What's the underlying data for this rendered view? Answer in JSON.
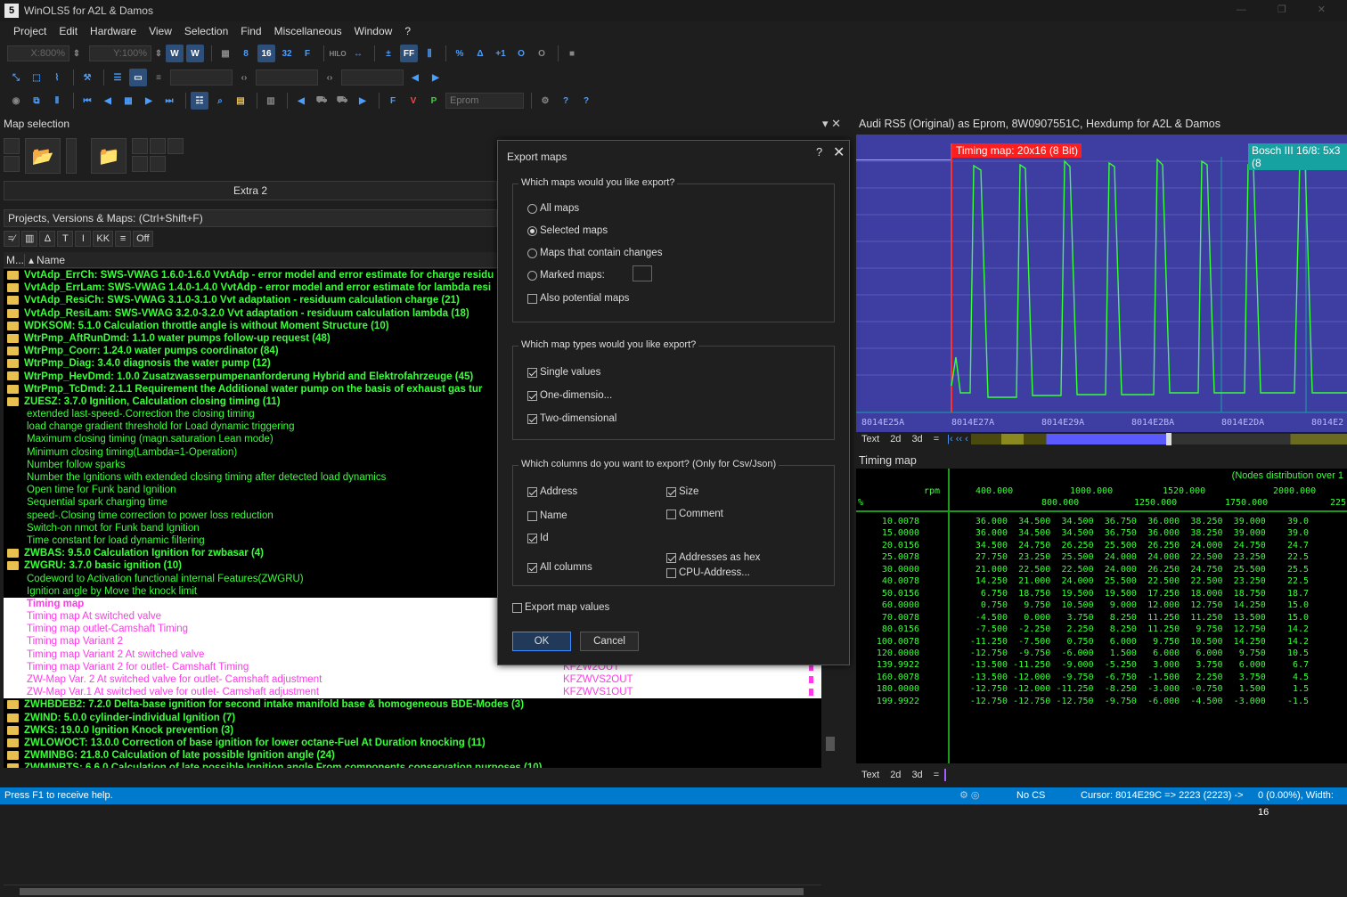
{
  "window": {
    "title": "WinOLS5 for A2L & Damos",
    "app_icon": "5"
  },
  "menu": [
    "Project",
    "Edit",
    "Hardware",
    "View",
    "Selection",
    "Find",
    "Miscellaneous",
    "Window",
    "?"
  ],
  "toolbar": {
    "x_zoom": "X:800%",
    "y_zoom": "Y:100%",
    "eprom_label": "Eprom",
    "hilo": "HILO"
  },
  "left_panel": {
    "title": "Map selection",
    "extra_button": "Extra 2",
    "search_label": "Projects, Versions & Maps:  (Ctrl+Shift+F)",
    "filter_off": "Off",
    "filter_kk": "KK",
    "col_m": "M...",
    "col_name": "Name",
    "rows": [
      {
        "type": "folder",
        "text": "VvtAdp_ErrCh: SWS-VWAG 1.6.0-1.6.0 VvtAdp - error model and error estimate for charge residu"
      },
      {
        "type": "folder",
        "text": "VvtAdp_ErrLam: SWS-VWAG 1.4.0-1.4.0 VvtAdp - error model and error estimate for lambda resi"
      },
      {
        "type": "folder",
        "text": "VvtAdp_ResiCh: SWS-VWAG 3.1.0-3.1.0 Vvt adaptation - residuum calculation charge (21)"
      },
      {
        "type": "folder",
        "text": "VvtAdp_ResiLam: SWS-VWAG 3.2.0-3.2.0 Vvt adaptation - residuum calculation lambda (18)"
      },
      {
        "type": "folder",
        "text": "WDKSOM: 5.1.0     Calculation throttle angle is without Moment Structure (10)"
      },
      {
        "type": "folder",
        "text": "WtrPmp_AftRunDmd: 1.1.0     water pumps follow-up request (48)"
      },
      {
        "type": "folder",
        "text": "WtrPmp_Coorr: 1.24.0     water pumps coordinator (84)"
      },
      {
        "type": "folder",
        "text": "WtrPmp_Diag: 3.4.0     diagnosis the water pump (12)"
      },
      {
        "type": "folder",
        "text": "WtrPmp_HevDmd: 1.0.0     Zusatzwasserpumpenanforderung Hybrid and Elektrofahrzeuge (45)"
      },
      {
        "type": "folder",
        "text": "WtrPmp_TcDmd: 2.1.1     Requirement the Additional water pump on the basis of exhaust gas tur"
      },
      {
        "type": "folder",
        "text": "ZUESZ: 3.7.0     Ignition, Calculation closing timing (11)"
      },
      {
        "type": "sub",
        "text": "extended last-speed-.Correction the closing timing"
      },
      {
        "type": "sub",
        "text": "load change gradient threshold for Load dynamic triggering"
      },
      {
        "type": "sub",
        "text": "Maximum closing timing (magn.saturation Lean mode)"
      },
      {
        "type": "sub",
        "text": "Minimum closing timing(Lambda=1-Operation)"
      },
      {
        "type": "sub",
        "text": "Number follow sparks"
      },
      {
        "type": "sub",
        "text": "Number the Ignitions with extended closing timing after detected load dynamics"
      },
      {
        "type": "sub",
        "text": "Open time for Funk band Ignition"
      },
      {
        "type": "sub",
        "text": "Sequential spark charging time"
      },
      {
        "type": "sub",
        "text": "speed-.Closing time correction to power loss reduction"
      },
      {
        "type": "sub",
        "text": "Switch-on nmot for Funk band Ignition"
      },
      {
        "type": "sub",
        "text": "Time constant for load dynamic filtering"
      },
      {
        "type": "folder",
        "text": "ZWBAS: 9.5.0     Calculation Ignition for zwbasar (4)"
      },
      {
        "type": "folder",
        "text": "ZWGRU: 3.7.0     basic ignition (10)"
      },
      {
        "type": "sub",
        "text": "Codeword to Activation functional internal Features(ZWGRU)"
      },
      {
        "type": "sub",
        "text": "Ignition angle by Move the knock limit"
      },
      {
        "type": "pink",
        "text": "Timing map",
        "id": "",
        "mark": false
      },
      {
        "type": "pink",
        "text": "Timing map At switched valve",
        "id": "",
        "mark": false
      },
      {
        "type": "pink",
        "text": "Timing map outlet-Camshaft Timing",
        "id": "",
        "mark": false
      },
      {
        "type": "pink",
        "text": "Timing map Variant 2",
        "id": "",
        "mark": false
      },
      {
        "type": "pink",
        "text": "Timing map Variant 2 At switched valve",
        "id": "",
        "mark": false
      },
      {
        "type": "pink",
        "text": "Timing map Variant 2 for outlet- Camshaft Timing",
        "id": "KFZW2OUT",
        "mark": true
      },
      {
        "type": "pink",
        "text": "ZW-Map Var. 2 At switched valve for outlet- Camshaft adjustment",
        "id": "KFZWVS2OUT",
        "mark": true
      },
      {
        "type": "pink",
        "text": "ZW-Map Var.1 At switched valve for outlet- Camshaft adjustment",
        "id": "KFZWVS1OUT",
        "mark": true
      },
      {
        "type": "folder",
        "text": "ZWHBDEB2: 7.2.0     Delta-base ignition for second intake manifold base & homogeneous BDE-Modes (3)"
      },
      {
        "type": "folder",
        "text": "ZWIND: 5.0.0     cylinder-individual Ignition (7)"
      },
      {
        "type": "folder",
        "text": "ZWKS: 19.0.0     Ignition Knock prevention (3)"
      },
      {
        "type": "folder",
        "text": "ZWLOWOCT: 13.0.0     Correction of base ignition for lower octane-Fuel At Duration knocking (11)"
      },
      {
        "type": "folder",
        "text": "ZWMINBG: 21.8.0     Calculation of late possible Ignition angle (24)"
      },
      {
        "type": "folder",
        "text": "ZWMINBTS: 6.6.0     Calculation of late possible Ignition angle From components conservation purposes (10)"
      }
    ]
  },
  "right_panel": {
    "title": "Audi RS5 (Original) as Eprom, 8W0907551C, Hexdump for A2L & Damos",
    "timing_tag": "Timing map: 20x16 (8 Bit)",
    "bosch_tag": "Bosch III 16/8: 5x3 (8",
    "addresses": [
      "8014E25A",
      "8014E27A",
      "8014E29A",
      "8014E2BA",
      "8014E2DA",
      "8014E2"
    ],
    "nav_tabs": [
      "Text",
      "2d",
      "3d",
      "="
    ],
    "map_title": "Timing map",
    "nodes_note": "(Nodes distribution over 1",
    "rpm_label": "rpm",
    "pct_label": "%",
    "x_top": [
      "400.000",
      "1000.000",
      "1520.000",
      "2000.000"
    ],
    "x_bottom": [
      "800.000",
      "1250.000",
      "1750.000",
      "225"
    ],
    "y_axis": [
      "10.0078",
      "15.0000",
      "20.0156",
      "25.0078",
      "30.0000",
      "40.0078",
      "50.0156",
      "60.0000",
      "70.0078",
      "80.0156",
      "100.0078",
      "120.0000",
      "139.9922",
      "160.0078",
      "180.0000",
      "199.9922"
    ],
    "table": [
      [
        "36.000",
        "34.500",
        "34.500",
        "36.750",
        "36.000",
        "38.250",
        "39.000",
        "39.0"
      ],
      [
        "36.000",
        "34.500",
        "34.500",
        "36.750",
        "36.000",
        "38.250",
        "39.000",
        "39.0"
      ],
      [
        "34.500",
        "24.750",
        "26.250",
        "25.500",
        "26.250",
        "24.000",
        "24.750",
        "24.7"
      ],
      [
        "27.750",
        "23.250",
        "25.500",
        "24.000",
        "24.000",
        "22.500",
        "23.250",
        "22.5"
      ],
      [
        "21.000",
        "22.500",
        "22.500",
        "24.000",
        "26.250",
        "24.750",
        "25.500",
        "25.5"
      ],
      [
        "14.250",
        "21.000",
        "24.000",
        "25.500",
        "22.500",
        "22.500",
        "23.250",
        "22.5"
      ],
      [
        "6.750",
        "18.750",
        "19.500",
        "19.500",
        "17.250",
        "18.000",
        "18.750",
        "18.7"
      ],
      [
        "0.750",
        "9.750",
        "10.500",
        "9.000",
        "12.000",
        "12.750",
        "14.250",
        "15.0"
      ],
      [
        "-4.500",
        "0.000",
        "3.750",
        "8.250",
        "11.250",
        "11.250",
        "13.500",
        "15.0"
      ],
      [
        "-7.500",
        "-2.250",
        "2.250",
        "8.250",
        "11.250",
        "9.750",
        "12.750",
        "14.2"
      ],
      [
        "-11.250",
        "-7.500",
        "0.750",
        "6.000",
        "9.750",
        "10.500",
        "14.250",
        "14.2"
      ],
      [
        "-12.750",
        "-9.750",
        "-6.000",
        "1.500",
        "6.000",
        "6.000",
        "9.750",
        "10.5"
      ],
      [
        "-13.500",
        "-11.250",
        "-9.000",
        "-5.250",
        "3.000",
        "3.750",
        "6.000",
        "6.7"
      ],
      [
        "-13.500",
        "-12.000",
        "-9.750",
        "-6.750",
        "-1.500",
        "2.250",
        "3.750",
        "4.5"
      ],
      [
        "-12.750",
        "-12.000",
        "-11.250",
        "-8.250",
        "-3.000",
        "-0.750",
        "1.500",
        "1.5"
      ],
      [
        "-12.750",
        "-12.750",
        "-12.750",
        "-9.750",
        "-6.000",
        "-4.500",
        "-3.000",
        "-1.5"
      ]
    ]
  },
  "dialog": {
    "title": "Export maps",
    "help": "?",
    "close": "✕",
    "group1": "Which maps would you like export?",
    "opt_all": "All maps",
    "opt_selected": "Selected maps",
    "opt_changes": "Maps that contain changes",
    "opt_marked": "Marked maps:",
    "opt_potential": "Also potential maps",
    "group2": "Which map types would you like export?",
    "opt_single": "Single values",
    "opt_one": "One-dimensio...",
    "opt_two": "Two-dimensional",
    "group3": "Which columns do you want to export? (Only for Csv/Json)",
    "col_address": "Address",
    "col_name": "Name",
    "col_id": "Id",
    "col_all": "All columns",
    "col_size": "Size",
    "col_comment": "Comment",
    "col_hex": "Addresses as hex",
    "col_cpu": "CPU-Address...",
    "export_values": "Export map values",
    "ok": "OK",
    "cancel": "Cancel"
  },
  "status": {
    "help": "Press F1 to receive help.",
    "cs": "No CS",
    "cursor": "Cursor: 8014E29C => 2223 (2223) ->",
    "width": "0 (0.00%), Width: 16"
  },
  "colors": {
    "list_green": "#39ff39",
    "list_pink": "#ff3ae8",
    "hex_bg": "#3d3da2",
    "status_blue": "#007acc",
    "timing_red": "#ff1e1e"
  }
}
